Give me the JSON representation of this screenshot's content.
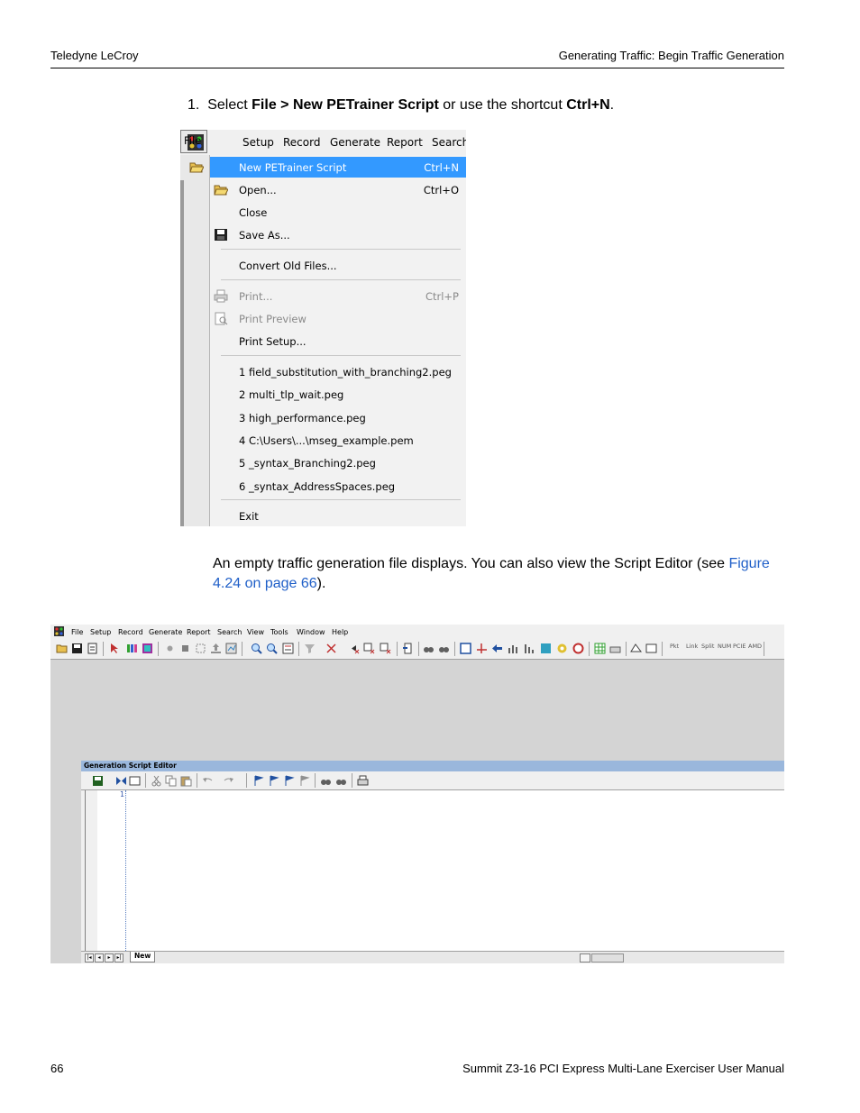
{
  "header": {
    "left": "Teledyne LeCroy",
    "right": "Generating Traffic: Begin Traffic Generation"
  },
  "footer": {
    "page_number": "66",
    "manual_title": "Summit Z3-16 PCI Express Multi-Lane Exerciser User Manual"
  },
  "step1": {
    "number": "1.",
    "pre": "Select ",
    "menu_path": "File > New PETrainer Script",
    "mid": " or use the shortcut ",
    "shortcut": "Ctrl+N",
    "post": "."
  },
  "file_menu_screenshot": {
    "menubar": [
      "File",
      "Setup",
      "Record",
      "Generate",
      "Report",
      "Search"
    ],
    "items": [
      {
        "label": "New PETrainer Script",
        "shortcut": "Ctrl+N",
        "state": "selected"
      },
      {
        "label": "Open...",
        "shortcut": "Ctrl+O",
        "state": "normal"
      },
      {
        "label": "Close",
        "shortcut": "",
        "state": "normal"
      },
      {
        "label": "Save As...",
        "shortcut": "",
        "state": "normal"
      },
      {
        "label": "Convert Old Files...",
        "shortcut": "",
        "state": "normal"
      },
      {
        "label": "Print...",
        "shortcut": "Ctrl+P",
        "state": "disabled"
      },
      {
        "label": "Print Preview",
        "shortcut": "",
        "state": "disabled"
      },
      {
        "label": "Print Setup...",
        "shortcut": "",
        "state": "normal"
      },
      {
        "label": "1 field_substitution_with_branching2.peg",
        "shortcut": "",
        "state": "normal"
      },
      {
        "label": "2 multi_tlp_wait.peg",
        "shortcut": "",
        "state": "normal"
      },
      {
        "label": "3 high_performance.peg",
        "shortcut": "",
        "state": "normal"
      },
      {
        "label": "4 C:\\Users\\...\\mseg_example.pem",
        "shortcut": "",
        "state": "normal"
      },
      {
        "label": "5 _syntax_Branching2.peg",
        "shortcut": "",
        "state": "normal"
      },
      {
        "label": "6 _syntax_AddressSpaces.peg",
        "shortcut": "",
        "state": "normal"
      },
      {
        "label": "Exit",
        "shortcut": "",
        "state": "normal"
      }
    ]
  },
  "paragraph": {
    "text": "An empty traffic generation file displays. You can also view the Script Editor (see ",
    "link": "Figure 4.24 on page 66",
    "end": ")."
  },
  "app_screenshot": {
    "menubar": [
      "File",
      "Setup",
      "Record",
      "Generate",
      "Report",
      "Search",
      "View",
      "Tools",
      "Window",
      "Help"
    ],
    "toolbar_text_buttons": [
      "Pkt",
      "Link",
      "Split",
      "NUM",
      "PCIE",
      "AMD"
    ],
    "editor_title": "Generation Script Editor",
    "line_number": "1",
    "tab_label": "New"
  },
  "colors": {
    "menu_highlight": "#3399ff",
    "link": "#1f5fc8",
    "editor_titlebar": "#9ab7dc"
  }
}
